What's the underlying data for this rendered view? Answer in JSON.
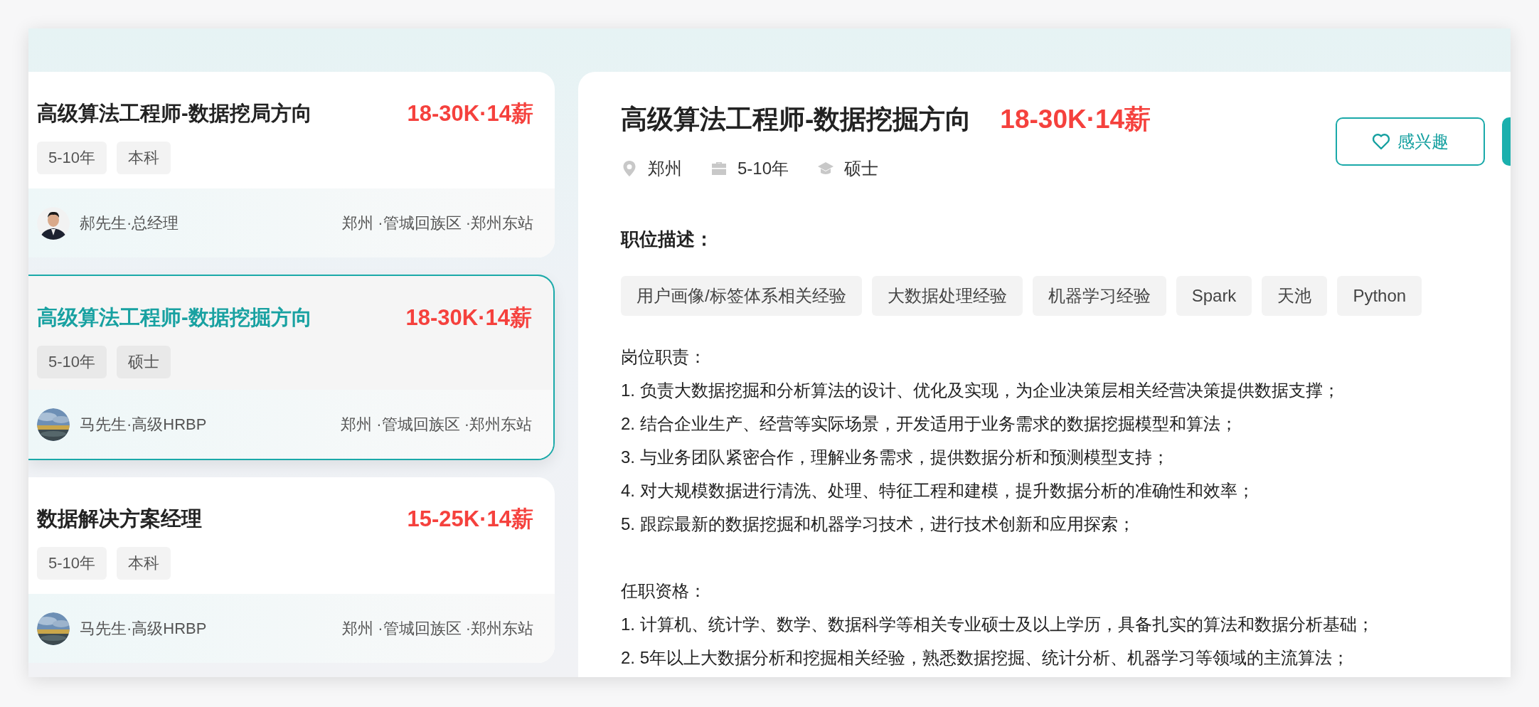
{
  "job_list": [
    {
      "title": "高级算法工程师-数据挖局方向",
      "salary": "18-30K·14薪",
      "tags": [
        "5-10年",
        "本科"
      ],
      "avatar": {
        "kind": "picture"
      },
      "recruiter": "郝先生·总经理",
      "location": "郑州 ·管城回族区 ·郑州东站",
      "selected": false
    },
    {
      "title": "高级算法工程师-数据挖掘方向",
      "salary": "18-30K·14薪",
      "tags": [
        "5-10年",
        "硕士"
      ],
      "avatar": {
        "kind": "picture"
      },
      "recruiter": "马先生·高级HRBP",
      "location": "郑州 ·管城回族区 ·郑州东站",
      "selected": true
    },
    {
      "title": "数据解决方案经理",
      "salary": "15-25K·14薪",
      "tags": [
        "5-10年",
        "本科"
      ],
      "avatar": {
        "kind": "picture"
      },
      "recruiter": "马先生·高级HRBP",
      "location": "郑州 ·管城回族区 ·郑州东站",
      "selected": false
    }
  ],
  "detail": {
    "title": "高级算法工程师-数据挖掘方向",
    "salary": "18-30K·14薪",
    "meta": [
      {
        "kind": "location",
        "text": "郑州"
      },
      {
        "kind": "experience",
        "text": "5-10年"
      },
      {
        "kind": "degree",
        "text": "硕士"
      }
    ],
    "interest_button": {
      "label": "感兴趣"
    },
    "section_title": "职位描述：",
    "skill_tags": [
      "用户画像/标签体系相关经验",
      "大数据处理经验",
      "机器学习经验",
      "Spark",
      "天池",
      "Python"
    ],
    "paragraphs": [
      {
        "heading": "岗位职责：",
        "lines": [
          "1. 负责大数据挖掘和分析算法的设计、优化及实现，为企业决策层相关经营决策提供数据支撑；",
          "2. 结合企业生产、经营等实际场景，开发适用于业务需求的数据挖掘模型和算法；",
          "3. 与业务团队紧密合作，理解业务需求，提供数据分析和预测模型支持；",
          "4. 对大规模数据进行清洗、处理、特征工程和建模，提升数据分析的准确性和效率；",
          "5. 跟踪最新的数据挖掘和机器学习技术，进行技术创新和应用探索；"
        ]
      },
      {
        "heading": "任职资格：",
        "lines": [
          "1. 计算机、统计学、数学、数据科学等相关专业硕士及以上学历，具备扎实的算法和数据分析基础；",
          "2. 5年以上大数据分析和挖掘相关经验，熟悉数据挖掘、统计分析、机器学习等领域的主流算法；"
        ]
      }
    ]
  }
}
